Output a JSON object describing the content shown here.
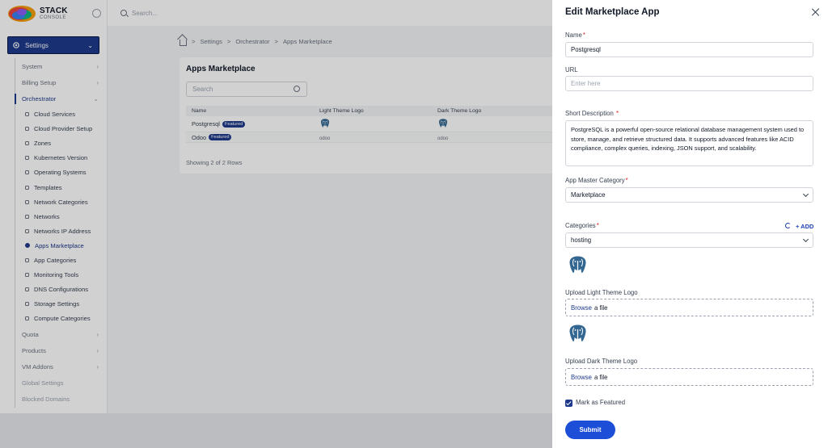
{
  "brand": {
    "line1": "STACK",
    "line2": "CONSOLE"
  },
  "topbar": {
    "search_placeholder": "Search..."
  },
  "sidebar": {
    "settings_label": "Settings",
    "items": [
      {
        "label": "System",
        "type": "group"
      },
      {
        "label": "Billing Setup",
        "type": "group"
      },
      {
        "label": "Orchestrator",
        "type": "open"
      },
      {
        "label": "Cloud Services",
        "type": "sub"
      },
      {
        "label": "Cloud Provider Setup",
        "type": "sub"
      },
      {
        "label": "Zones",
        "type": "sub"
      },
      {
        "label": "Kubernetes Version",
        "type": "sub"
      },
      {
        "label": "Operating Systems",
        "type": "sub"
      },
      {
        "label": "Templates",
        "type": "sub"
      },
      {
        "label": "Network Categories",
        "type": "sub"
      },
      {
        "label": "Networks",
        "type": "sub"
      },
      {
        "label": "Networks IP Address",
        "type": "sub"
      },
      {
        "label": "Apps Marketplace",
        "type": "sub-active"
      },
      {
        "label": "App Categories",
        "type": "sub"
      },
      {
        "label": "Monitoring Tools",
        "type": "sub"
      },
      {
        "label": "DNS Configurations",
        "type": "sub"
      },
      {
        "label": "Storage Settings",
        "type": "sub"
      },
      {
        "label": "Compute Categories",
        "type": "sub"
      },
      {
        "label": "Quota",
        "type": "group"
      },
      {
        "label": "Products",
        "type": "group"
      },
      {
        "label": "VM Addons",
        "type": "group"
      },
      {
        "label": "Global Settings",
        "type": "plain"
      },
      {
        "label": "Blocked Domains",
        "type": "plain"
      }
    ]
  },
  "breadcrumb": {
    "items": [
      "Settings",
      "Orchestrator",
      "Apps Marketplace"
    ],
    "sep": ">"
  },
  "page": {
    "title": "Apps Marketplace",
    "search_placeholder": "Search",
    "columns": [
      "Name",
      "Light Theme Logo",
      "Dark Theme Logo"
    ],
    "rows": [
      {
        "name": "Postgresql",
        "badge": "Featured",
        "light": "",
        "dark": ""
      },
      {
        "name": "Odoo",
        "badge": "Featured",
        "light": "odoo",
        "dark": "odoo"
      }
    ],
    "showing": "Showing 2 of 2 Rows"
  },
  "drawer": {
    "title": "Edit Marketplace App",
    "name_label": "Name",
    "name_value": "Postgresql",
    "url_label": "URL",
    "url_placeholder": "Enter here",
    "desc_label": "Short Description",
    "desc_value": "PostgreSQL is a powerful open-source relational database management system used to store, manage, and retrieve structured data. It supports advanced features like ACID compliance, complex queries, indexing, JSON support, and scalability.",
    "master_label": "App Master Category",
    "master_value": "Marketplace",
    "categories_label": "Categories",
    "add_label": "+ ADD",
    "categories_value": "hosting",
    "light_logo_label": "Upload Light Theme Logo",
    "dark_logo_label": "Upload Dark Theme Logo",
    "browse": "Browse",
    "a_file": "a file",
    "featured_label": "Mark as Featured",
    "submit_label": "Submit",
    "required_mark": "*",
    "logo_color": "#336791"
  }
}
